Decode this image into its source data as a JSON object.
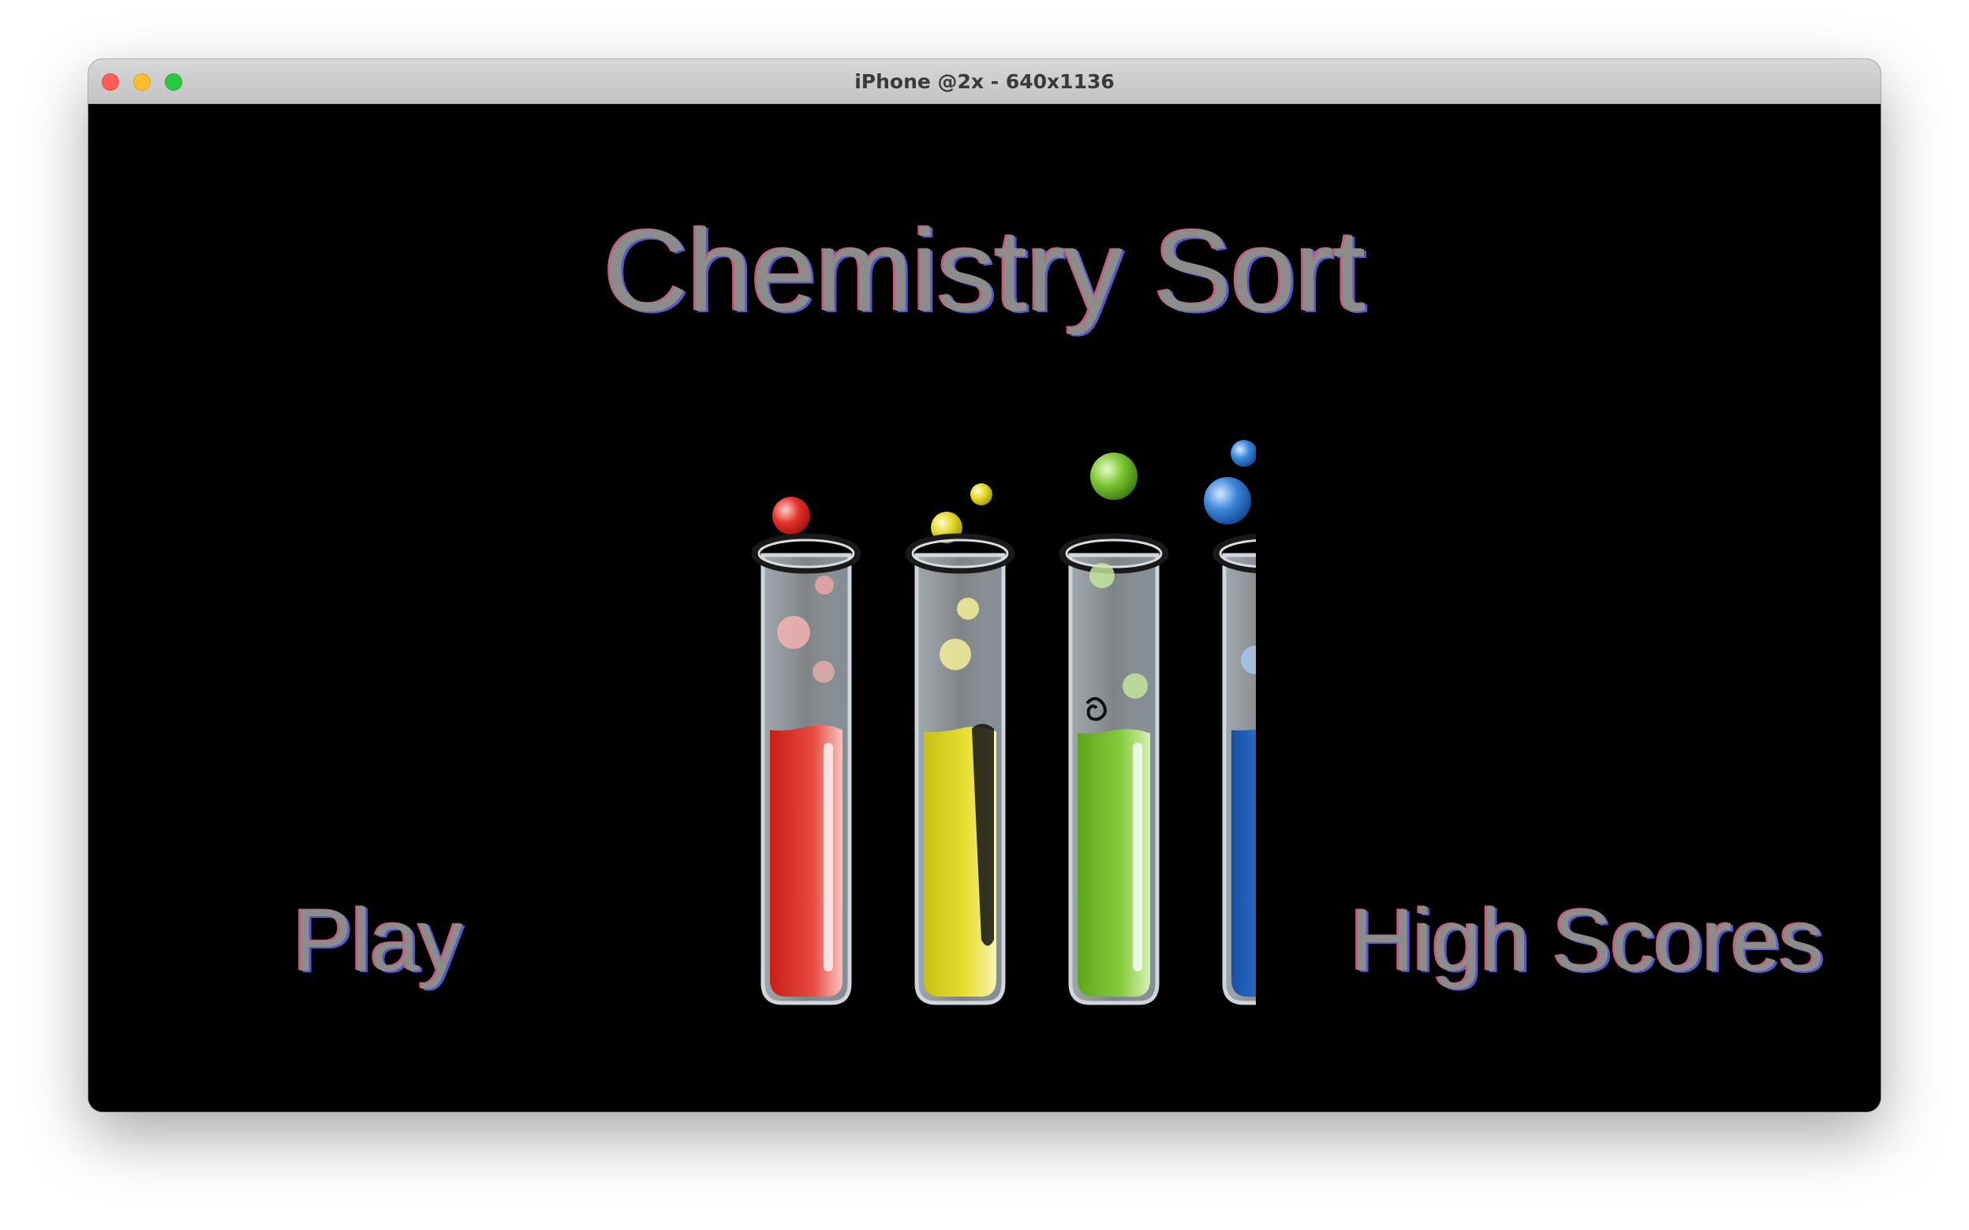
{
  "window": {
    "title": "iPhone @2x - 640x1136"
  },
  "game": {
    "title": "Chemistry Sort",
    "play_label": "Play",
    "high_scores_label": "High Scores"
  },
  "tubes": [
    {
      "name": "red",
      "color": "#e5332a",
      "light": "#f5a3a0"
    },
    {
      "name": "yellow",
      "color": "#e4d92a",
      "light": "#f3ee9a"
    },
    {
      "name": "green",
      "color": "#7cc534",
      "light": "#c8eaa0"
    },
    {
      "name": "blue",
      "color": "#2d6fcd",
      "light": "#a9c8f0"
    }
  ],
  "colors": {
    "title_text": "#8c8c8c",
    "shadow_pink": "#c0617a",
    "shadow_blue": "#5a58c8",
    "background": "#000000"
  }
}
